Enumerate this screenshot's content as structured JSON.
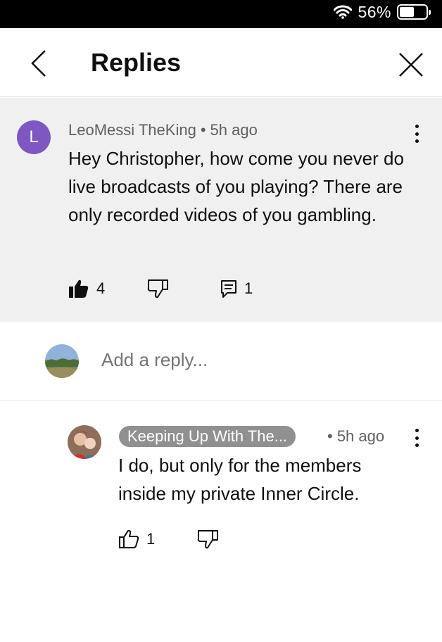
{
  "status_bar": {
    "battery_percent": "56%",
    "battery_level": 0.56
  },
  "header": {
    "title": "Replies"
  },
  "parent_comment": {
    "avatar_letter": "L",
    "author": "LeoMessi TheKing",
    "separator": "•",
    "time": "5h ago",
    "text": "Hey Christopher, how come you never do live broadcasts of you playing? There are only recorded videos of you gambling.",
    "like_count": "4",
    "reply_count": "1"
  },
  "add_reply": {
    "placeholder": "Add a reply..."
  },
  "reply": {
    "author": "Keeping Up With The...",
    "time": "• 5h ago",
    "text": "I do, but only for the members inside my private Inner Circle.",
    "like_count": "1"
  },
  "colors": {
    "avatar_purple": "#7e57c2",
    "chip_gray": "#909090",
    "panel_gray": "#f0f0f0"
  }
}
